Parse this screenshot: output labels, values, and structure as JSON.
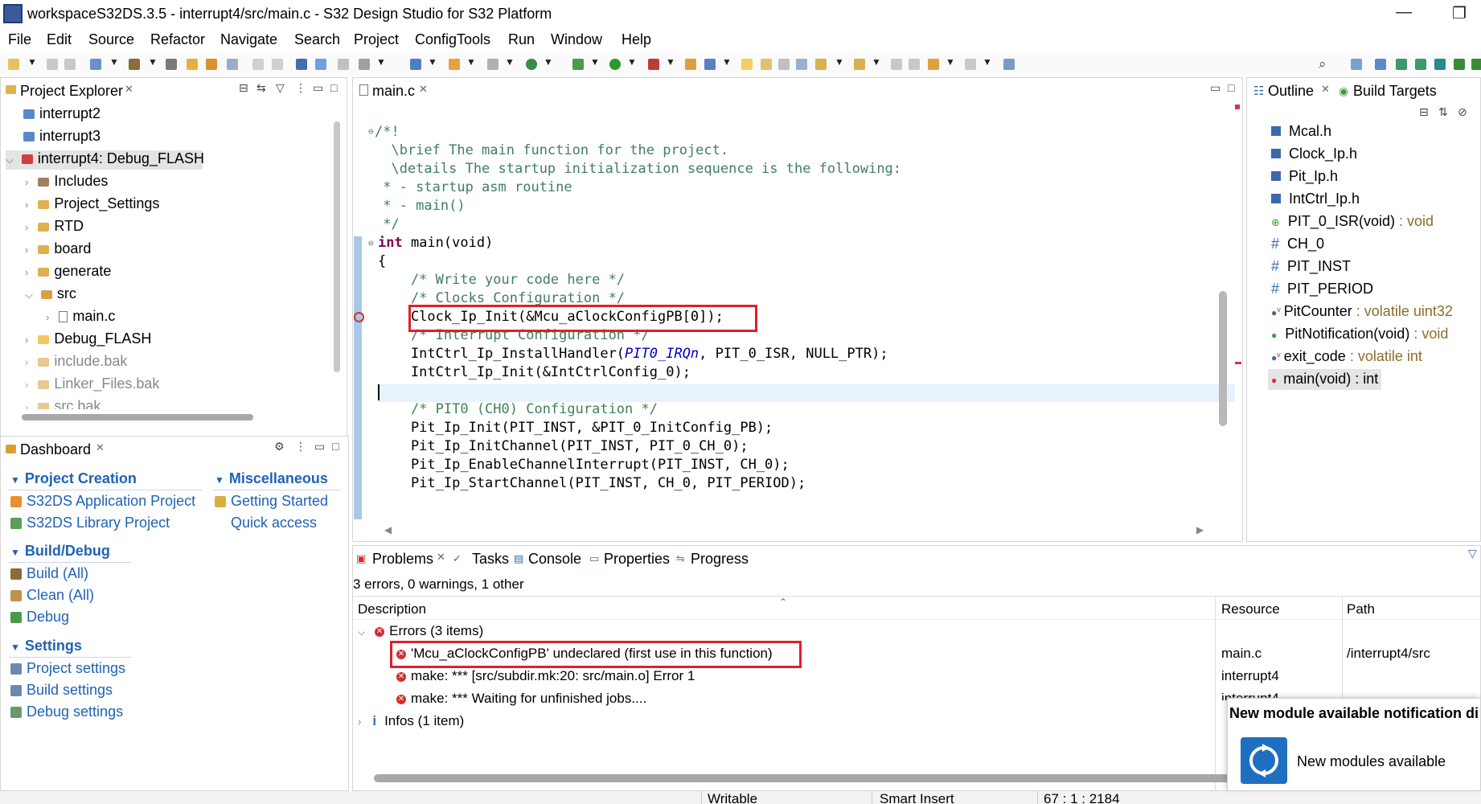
{
  "window": {
    "title": "workspaceS32DS.3.5 - interrupt4/src/main.c - S32 Design Studio for S32 Platform",
    "minimize": "—",
    "maximize": "❐"
  },
  "menu": [
    "File",
    "Edit",
    "Source",
    "Refactor",
    "Navigate",
    "Search",
    "Project",
    "ConfigTools",
    "Run",
    "Window",
    "Help"
  ],
  "project_explorer": {
    "tab": "Project Explorer",
    "items": [
      {
        "label": "interrupt2"
      },
      {
        "label": "interrupt3"
      },
      {
        "label": "interrupt4: Debug_FLASH"
      },
      {
        "label": "Includes"
      },
      {
        "label": "Project_Settings"
      },
      {
        "label": "RTD"
      },
      {
        "label": "board"
      },
      {
        "label": "generate"
      },
      {
        "label": "src"
      },
      {
        "label": "main.c"
      },
      {
        "label": "Debug_FLASH"
      },
      {
        "label": "include.bak"
      },
      {
        "label": "Linker_Files.bak"
      },
      {
        "label": "src.bak"
      }
    ]
  },
  "dashboard": {
    "tab": "Dashboard",
    "project_creation": "Project Creation",
    "app_project": "S32DS Application Project",
    "lib_project": "S32DS Library Project",
    "misc": "Miscellaneous",
    "getting_started": "Getting Started",
    "quick_access": "Quick access",
    "build_debug": "Build/Debug",
    "build_all": "Build  (All)",
    "clean_all": "Clean  (All)",
    "debug": "Debug",
    "settings": "Settings",
    "project_settings": "Project settings",
    "build_settings": "Build settings",
    "debug_settings": "Debug settings"
  },
  "editor": {
    "tab": "main.c",
    "lines": [
      "/*!",
      "  \\brief The main function for the project.",
      "  \\details The startup initialization sequence is the following:",
      " * - startup asm routine",
      " * - main()",
      " */",
      "int main(void)",
      "{",
      "    /* Write your code here */",
      "    /* Clocks Configuration */",
      "    Clock_Ip_Init(&Mcu_aClockConfigPB[0]);",
      "    /* Interrupt Configuration */",
      "    IntCtrl_Ip_InstallHandler(PIT0_IRQn, PIT_0_ISR, NULL_PTR);",
      "    IntCtrl_Ip_Init(&IntCtrlConfig_0);",
      "",
      "    /* PIT0 (CH0) Configuration */",
      "    Pit_Ip_Init(PIT_INST, &PIT_0_InitConfig_PB);",
      "    Pit_Ip_InitChannel(PIT_INST, PIT_0_CH_0);",
      "    Pit_Ip_EnableChannelInterrupt(PIT_INST, CH_0);",
      "    Pit_Ip_StartChannel(PIT_INST, CH_0, PIT_PERIOD);"
    ],
    "kw_int": "int",
    "main_sig": " main(void)",
    "irq_pre": "    IntCtrl_Ip_InstallHandler(",
    "irq_name": "PIT0_IRQn",
    "irq_post": ", PIT_0_ISR, NULL_PTR);"
  },
  "outline": {
    "tab_outline": "Outline",
    "tab_build": "Build Targets",
    "items": [
      {
        "name": "Mcal.h",
        "type": ""
      },
      {
        "name": "Clock_Ip.h",
        "type": ""
      },
      {
        "name": "Pit_Ip.h",
        "type": ""
      },
      {
        "name": "IntCtrl_Ip.h",
        "type": ""
      },
      {
        "name": "PIT_0_ISR(void)",
        "type": " : void"
      },
      {
        "name": "CH_0",
        "type": ""
      },
      {
        "name": "PIT_INST",
        "type": ""
      },
      {
        "name": "PIT_PERIOD",
        "type": ""
      },
      {
        "name": "PitCounter",
        "type": " : volatile uint32"
      },
      {
        "name": "PitNotification(void)",
        "type": " : void"
      },
      {
        "name": "exit_code",
        "type": " : volatile int"
      },
      {
        "name": "main(void) : int",
        "type": ""
      }
    ]
  },
  "problems": {
    "tabs": [
      "Problems",
      "Tasks",
      "Console",
      "Properties",
      "Progress"
    ],
    "summary": "3 errors, 0 warnings, 1 other",
    "col_desc": "Description",
    "col_resource": "Resource",
    "col_path": "Path",
    "errors_group": "Errors (3 items)",
    "rows": [
      {
        "desc": "'Mcu_aClockConfigPB' undeclared (first use in this function)",
        "resource": "main.c",
        "path": "/interrupt4/src"
      },
      {
        "desc": "make: *** [src/subdir.mk:20: src/main.o] Error 1",
        "resource": "interrupt4",
        "path": ""
      },
      {
        "desc": "make: *** Waiting for unfinished jobs....",
        "resource": "interrupt4",
        "path": ""
      }
    ],
    "infos_group": "Infos (1 item)"
  },
  "statusbar": {
    "writable": "Writable",
    "insert": "Smart Insert",
    "position": "67 : 1 : 2184"
  },
  "notification": {
    "title": "New module available notification di",
    "text": "New modules available"
  }
}
